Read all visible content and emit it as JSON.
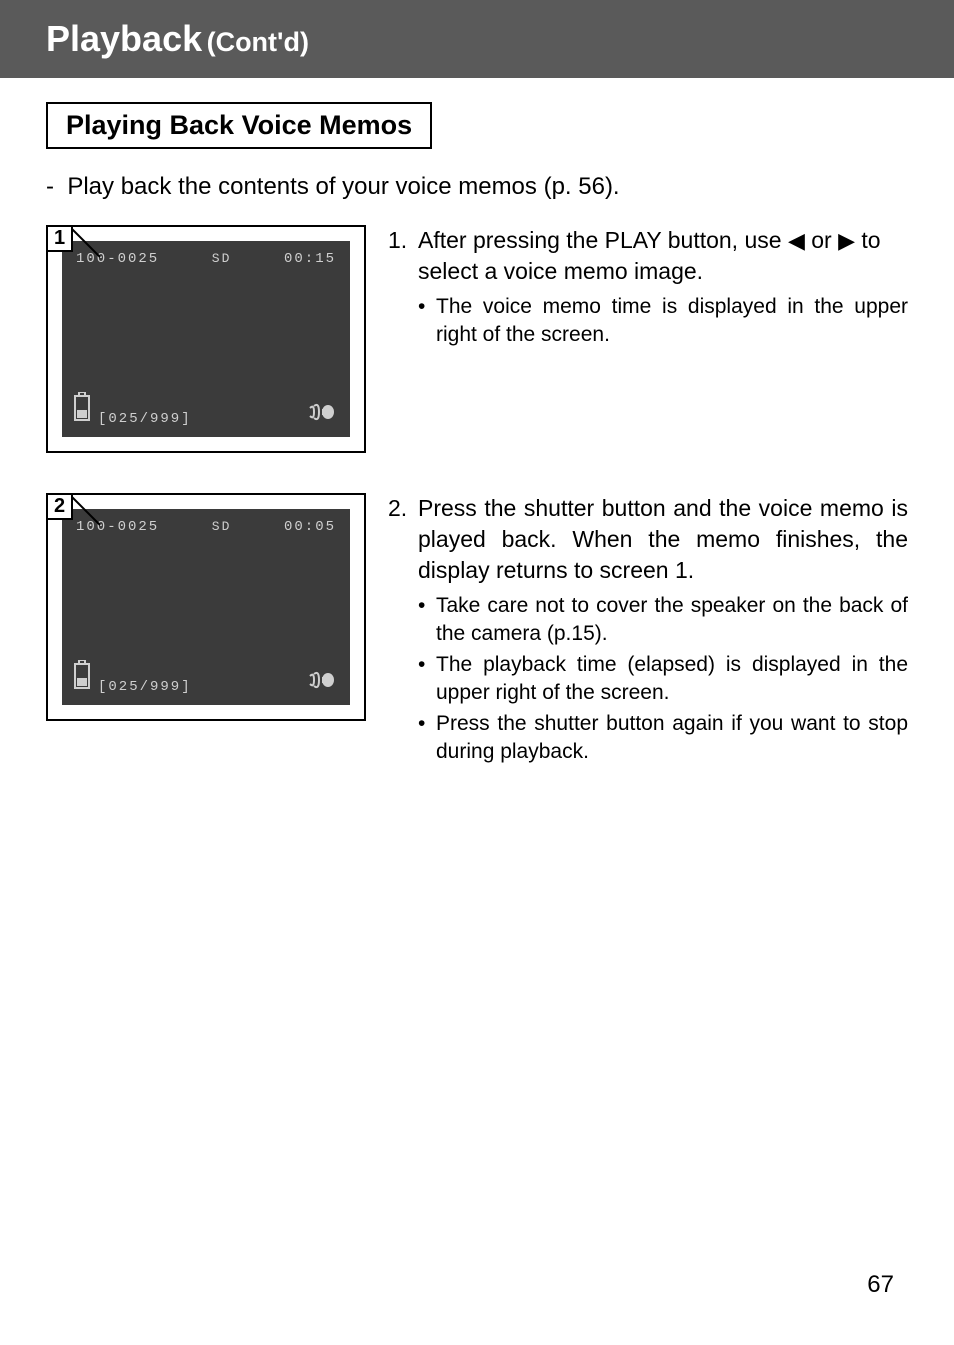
{
  "header": {
    "title": "Playback",
    "cont": "(Cont'd)"
  },
  "section_title": "Playing Back Voice Memos",
  "intro_dash": "-",
  "intro": "Play back the contents of your voice memos (p. 56).",
  "arrows": {
    "left": "◀",
    "right": "▶"
  },
  "screens": [
    {
      "badge": "1",
      "file": "100-0025",
      "card": "SD",
      "time": "00:15",
      "counter": "[025/999]"
    },
    {
      "badge": "2",
      "file": "100-0025",
      "card": "SD",
      "time": "00:05",
      "counter": "[025/999]"
    }
  ],
  "steps": [
    {
      "num": "1.",
      "text_pre": "After pressing the PLAY button, use ",
      "text_mid": " or ",
      "text_post": " to select a voice memo image.",
      "bullets": [
        "The voice memo time is displayed in the upper right of the screen."
      ]
    },
    {
      "num": "2.",
      "text": "Press the shutter button and the voice memo is played back. When the memo finishes, the display returns to screen 1.",
      "bullets": [
        "Take care not to cover the speaker on the back of the camera (p.15).",
        "The playback time (elapsed) is displayed in the upper right of the screen.",
        "Press the shutter button again if you want to stop during playback."
      ]
    }
  ],
  "page_number": "67"
}
